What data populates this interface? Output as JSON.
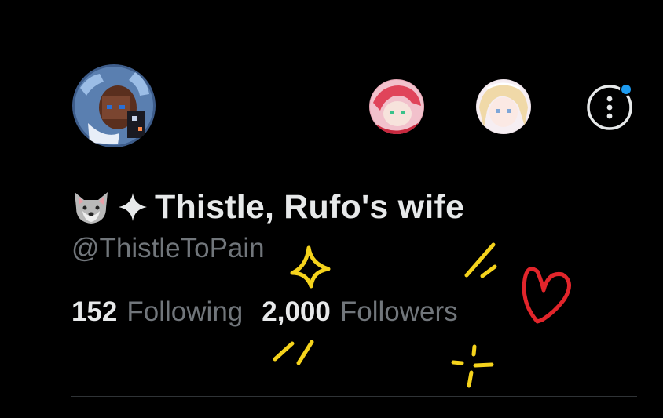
{
  "profile": {
    "display_name": "Thistle, Rufo's wife",
    "name_emojis": [
      "wolf-emoji",
      "sparkle-emoji"
    ],
    "handle": "@ThistleToPain",
    "avatar": "pixel-art-avatar"
  },
  "stats": {
    "following_count": "152",
    "following_label": "Following",
    "followers_count": "2,000",
    "followers_label": "Followers"
  },
  "account_switcher": [
    {
      "avatar": "pink-haired-anime-avatar"
    },
    {
      "avatar": "blonde-anime-avatar"
    }
  ],
  "more_button": {
    "icon": "more-vertical-icon",
    "notification_dot": true
  },
  "colors": {
    "background": "#000000",
    "primary_text": "#e7e9ea",
    "secondary_text": "#71767b",
    "notification_blue": "#1d9bf0",
    "doodle_yellow": "#f5d31c",
    "doodle_red": "#e2252b"
  }
}
